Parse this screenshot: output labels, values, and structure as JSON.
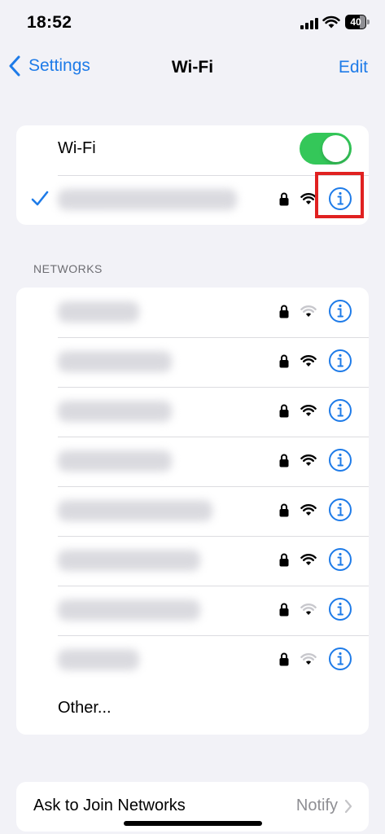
{
  "status_bar": {
    "time": "18:52",
    "battery_level": "40"
  },
  "nav": {
    "back_label": "Settings",
    "title": "Wi-Fi",
    "edit_label": "Edit"
  },
  "wifi_section": {
    "toggle_label": "Wi-Fi",
    "toggle_on": true,
    "connected_network": {
      "secured": true,
      "signal": "full",
      "name_obscured": true
    }
  },
  "networks_section": {
    "header": "NETWORKS",
    "networks": [
      {
        "secured": true,
        "signal": "weak",
        "name_obscured": true
      },
      {
        "secured": true,
        "signal": "full",
        "name_obscured": true
      },
      {
        "secured": true,
        "signal": "full",
        "name_obscured": true
      },
      {
        "secured": true,
        "signal": "full",
        "name_obscured": true
      },
      {
        "secured": true,
        "signal": "full",
        "name_obscured": true
      },
      {
        "secured": true,
        "signal": "full",
        "name_obscured": true
      },
      {
        "secured": true,
        "signal": "weak",
        "name_obscured": true
      },
      {
        "secured": true,
        "signal": "weak",
        "name_obscured": true
      }
    ],
    "other_label": "Other..."
  },
  "ask_to_join": {
    "label": "Ask to Join Networks",
    "value": "Notify"
  },
  "colors": {
    "accent": "#1e7be8",
    "toggle_on": "#34c759",
    "highlight": "#e02121",
    "background": "#f2f2f7"
  },
  "icons": [
    "lock-icon",
    "wifi-icon",
    "info-icon",
    "checkmark-icon",
    "chevron-left-icon",
    "chevron-right-icon"
  ]
}
